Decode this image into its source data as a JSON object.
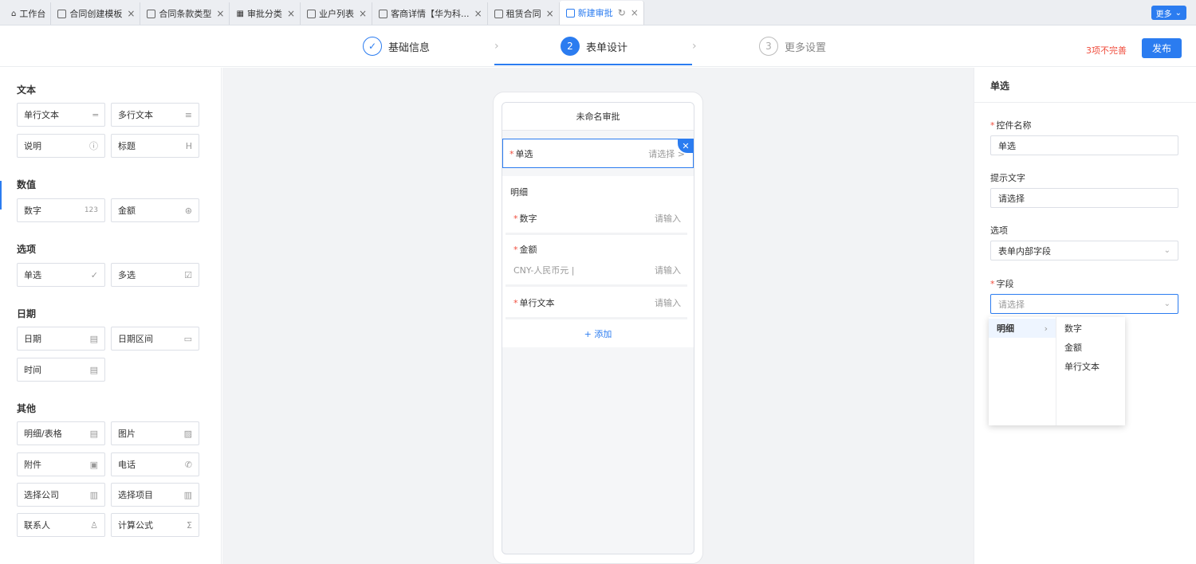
{
  "tabs": [
    {
      "label": "工作台",
      "icon": "home-icon",
      "closable": false
    },
    {
      "label": "合同创建模板",
      "icon": "doc-icon",
      "closable": true
    },
    {
      "label": "合同条款类型",
      "icon": "doc-icon",
      "closable": true
    },
    {
      "label": "审批分类",
      "icon": "grid-icon",
      "closable": true
    },
    {
      "label": "业户列表",
      "icon": "doc-icon",
      "closable": true
    },
    {
      "label": "客商详情【华为科...",
      "icon": "doc-icon",
      "closable": true
    },
    {
      "label": "租赁合同",
      "icon": "doc-icon",
      "closable": true
    },
    {
      "label": "新建审批",
      "icon": "doc-icon",
      "closable": true,
      "active": true
    }
  ],
  "more_label": "更多",
  "steps": [
    {
      "num": "✓",
      "label": "基础信息"
    },
    {
      "num": "2",
      "label": "表单设计"
    },
    {
      "num": "3",
      "label": "更多设置"
    }
  ],
  "warning": "3项不完善",
  "publish_label": "发布",
  "left": {
    "groups": {
      "text": "文本",
      "number": "数值",
      "option": "选项",
      "date": "日期",
      "other": "其他"
    },
    "comps": {
      "single_text": "单行文本",
      "multi_text": "多行文本",
      "explain": "说明",
      "heading": "标题",
      "number": "数字",
      "amount": "金额",
      "single_select": "单选",
      "multi_select": "多选",
      "date": "日期",
      "date_range": "日期区间",
      "time": "时间",
      "detail_table": "明细/表格",
      "image": "图片",
      "attachment": "附件",
      "phone": "电话",
      "company": "选择公司",
      "project": "选择项目",
      "contact": "联系人",
      "formula": "计算公式"
    }
  },
  "form": {
    "title": "未命名审批",
    "selected_field": {
      "label": "单选",
      "placeholder": "请选择 >"
    },
    "detail": {
      "title": "明细",
      "fields": [
        {
          "label": "数字",
          "placeholder": "请输入"
        },
        {
          "label": "金额",
          "currency": "CNY-人民币元  |",
          "placeholder": "请输入"
        },
        {
          "label": "单行文本",
          "placeholder": "请输入"
        }
      ],
      "add_label": "+ 添加"
    }
  },
  "right": {
    "title": "单选",
    "name_label": "控件名称",
    "name_value": "单选",
    "hint_label": "提示文字",
    "hint_value": "请选择",
    "option_label": "选项",
    "option_value": "表单内部字段",
    "field_label": "字段",
    "field_placeholder": "请选择"
  },
  "cascader": {
    "level1": [
      "明细"
    ],
    "level2": [
      "数字",
      "金额",
      "单行文本"
    ]
  },
  "colors": {
    "accent": "#2b7cf0",
    "warning": "#f04e3e"
  }
}
